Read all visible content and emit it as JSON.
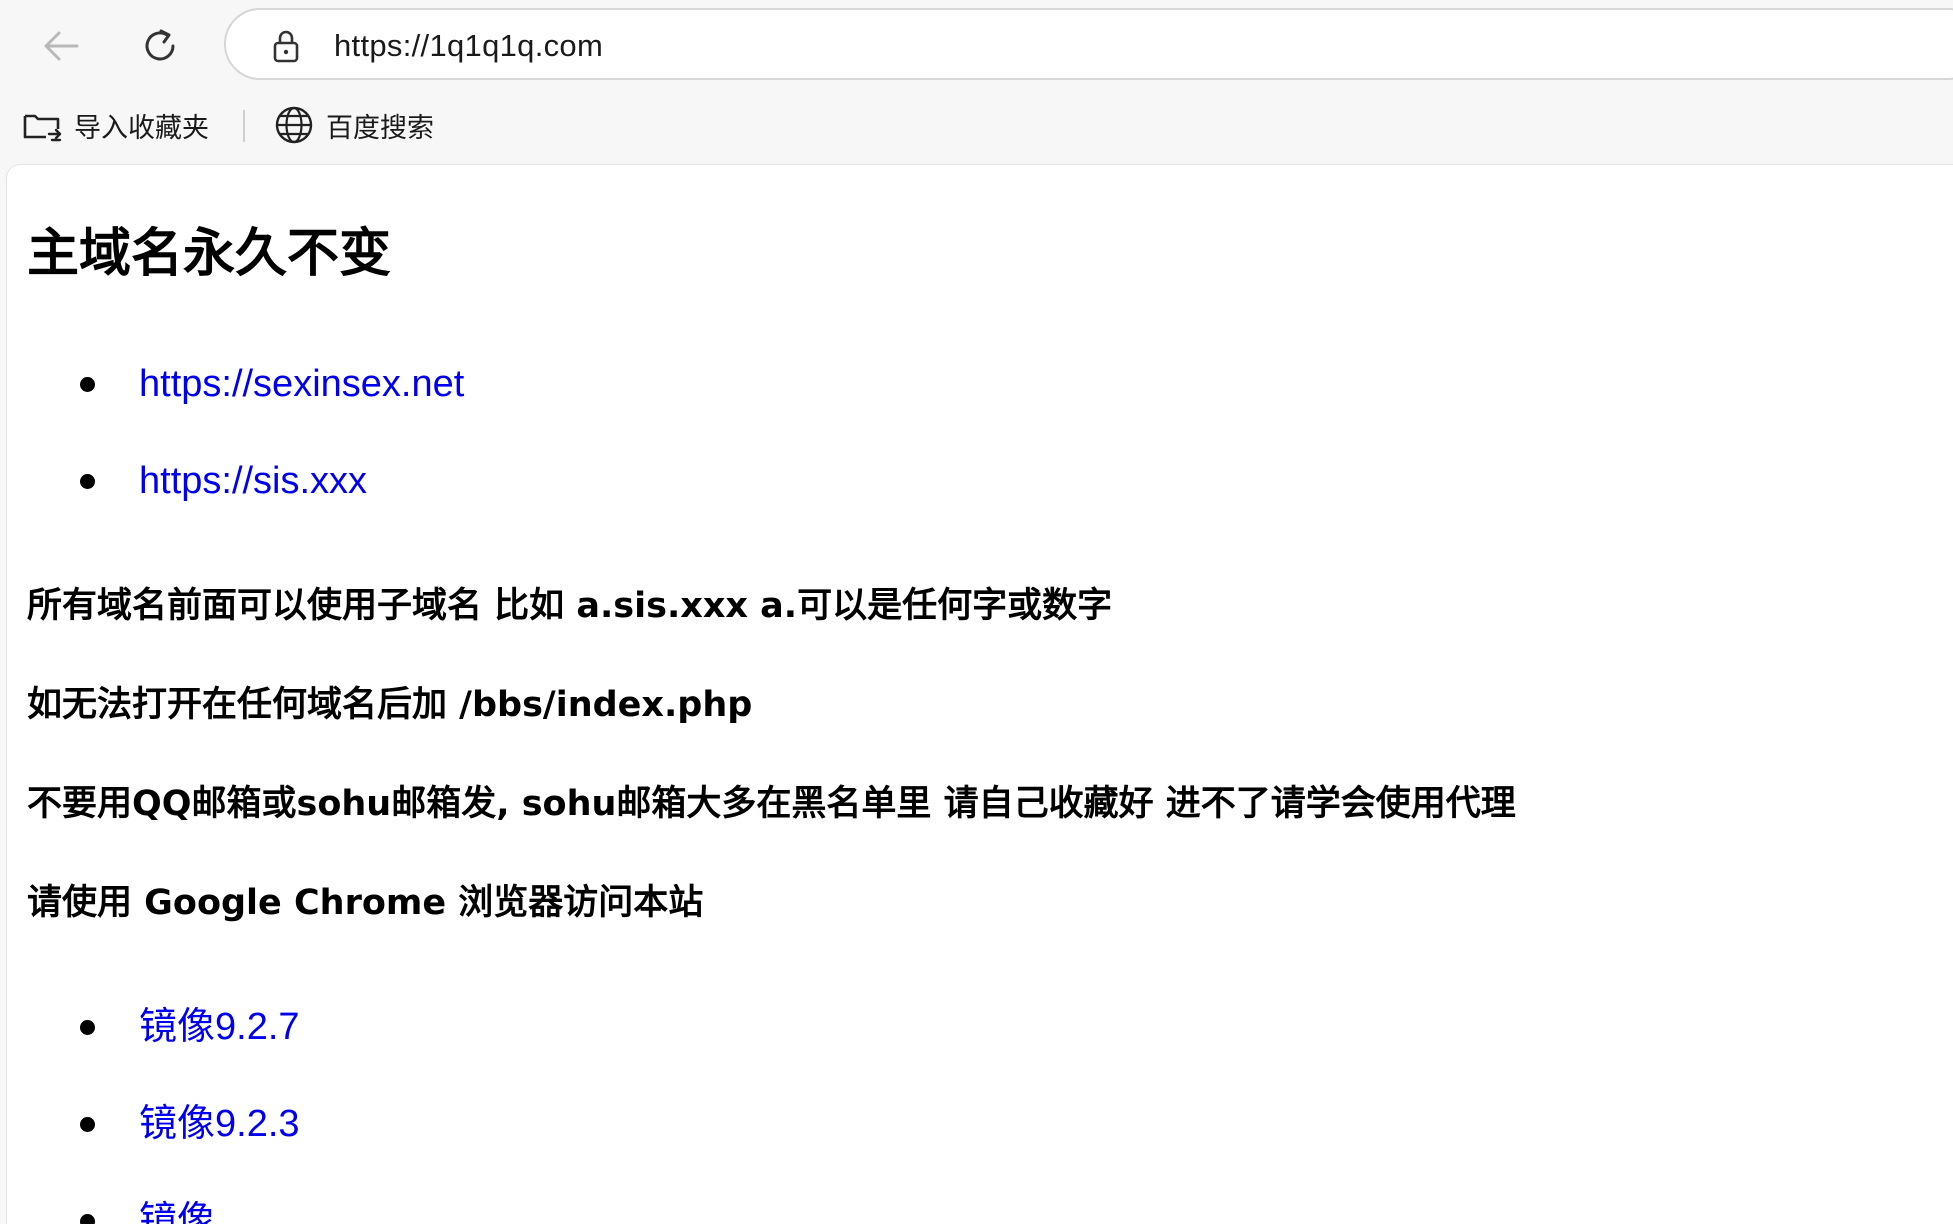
{
  "browser": {
    "url": "https://1q1q1q.com",
    "bookmarks": [
      {
        "label": "导入收藏夹",
        "icon": "import-favorites-icon"
      },
      {
        "label": "百度搜索",
        "icon": "globe-icon"
      }
    ]
  },
  "page": {
    "title": "主域名永久不变",
    "primary_links": [
      "https://sexinsex.net",
      "https://sis.xxx"
    ],
    "notes": [
      "所有域名前面可以使用子域名 比如 a.sis.xxx   a.可以是任何字或数字",
      "如无法打开在任何域名后加 /bbs/index.php",
      "不要用QQ邮箱或sohu邮箱发, sohu邮箱大多在黑名单里 请自己收藏好 进不了请学会使用代理",
      "请使用 Google Chrome 浏览器访问本站"
    ],
    "mirror_links": [
      "镜像9.2.7",
      "镜像9.2.3",
      "镜像"
    ]
  },
  "colors": {
    "link": "#0000ee",
    "chrome_bg": "#f7f7f7",
    "page_bg": "#ffffff"
  }
}
